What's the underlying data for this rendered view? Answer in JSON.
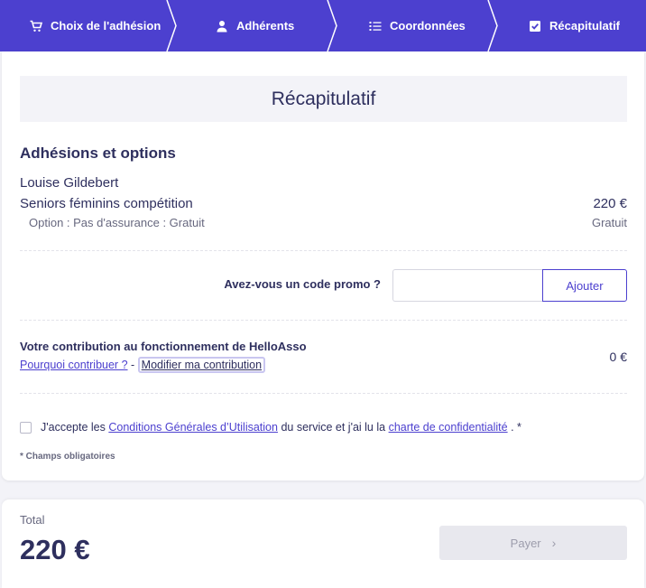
{
  "stepper": {
    "steps": [
      {
        "label": "Choix de l'adhésion",
        "icon": "cart-icon"
      },
      {
        "label": "Adhérents",
        "icon": "user-icon"
      },
      {
        "label": "Coordonnées",
        "icon": "list-icon"
      },
      {
        "label": "Récapitulatif",
        "icon": "checkbox-icon"
      }
    ],
    "active_step": 3,
    "color": "#4c40cf"
  },
  "recap": {
    "heading": "Récapitulatif",
    "section_title": "Adhésions et options",
    "member": {
      "name": "Louise Gildebert",
      "tier": "Seniors féminins compétition",
      "tier_price": "220 €",
      "option": "Option : Pas d'assurance : Gratuit",
      "option_price": "Gratuit"
    }
  },
  "promo": {
    "label": "Avez-vous un code promo ?",
    "input_value": "",
    "button_label": "Ajouter"
  },
  "contribution": {
    "title": "Votre contribution au fonctionnement de HelloAsso",
    "why_link": "Pourquoi contribuer ?",
    "separator": "-",
    "modify_link": "Modifier ma contribution",
    "amount": "0 €"
  },
  "terms": {
    "prefix": "J'accepte les",
    "cgu_link": "Conditions Générales d’Utilisation",
    "middle": "du service et j'ai lu la",
    "privacy_link": "charte de confidentialité",
    "suffix": ". *",
    "checked": false
  },
  "required_note": "* Champs obligatoires",
  "total": {
    "label": "Total",
    "amount": "220 €",
    "pay_label": "Payer",
    "pay_enabled": false
  }
}
